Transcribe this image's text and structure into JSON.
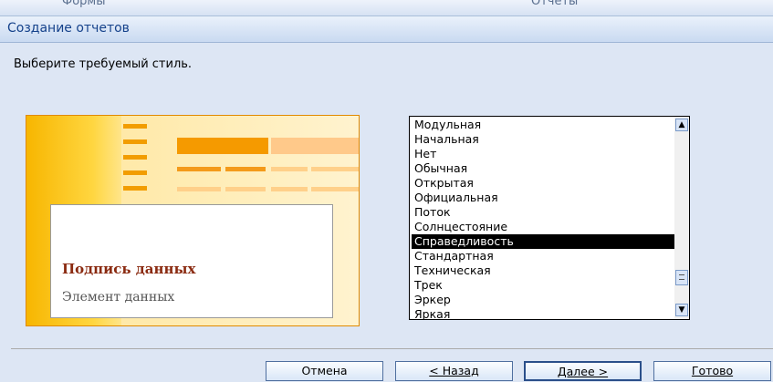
{
  "background_tabs": {
    "left": "Формы",
    "right": "Отчеты"
  },
  "dialog": {
    "title": "Создание отчетов",
    "prompt": "Выберите требуемый стиль.",
    "preview": {
      "caption": "Подпись данных",
      "element": "Элемент данных"
    },
    "styles": [
      "Модульная",
      "Начальная",
      "Нет",
      "Обычная",
      "Открытая",
      "Официальная",
      "Поток",
      "Солнцестояние",
      "Справедливость",
      "Стандартная",
      "Техническая",
      "Трек",
      "Эркер",
      "Яркая"
    ],
    "selected_style": "Справедливость",
    "buttons": {
      "cancel": "Отмена",
      "back": "< Назад",
      "next": "Далее >",
      "finish": "Готово"
    }
  },
  "colors": {
    "accent": "#15428b",
    "preview_orange": "#f59a00"
  }
}
